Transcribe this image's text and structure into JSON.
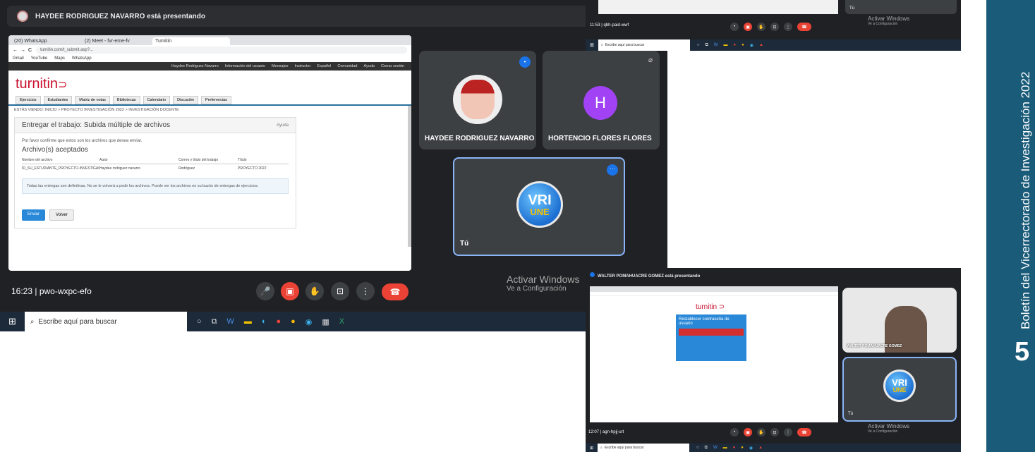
{
  "main": {
    "presenter_banner": "HAYDEE RODRIGUEZ NAVARRO está presentando",
    "browser": {
      "tabs": [
        "(20) WhatsApp",
        "(2) Meet - fvr-eme-fv",
        "Turnitin"
      ],
      "url": "turnitin.com/t_submit.asp?...",
      "bookmarks": [
        "Gmail",
        "YouTube",
        "Maps",
        "WhatsApp"
      ],
      "topnav": [
        "Haydee Rodriguez Navarro",
        "Información del usuario",
        "Mensajes",
        "Instructor",
        "Español",
        "Comunidad",
        "Ayuda",
        "Cerrar sesión"
      ],
      "logo": "turnitin",
      "menu_tabs": [
        "Ejercicios",
        "Estudiantes",
        "Matriz de notas",
        "Bibliotecas",
        "Calendario",
        "Discusión",
        "Preferencias"
      ],
      "breadcrumb": "ESTÁS VIENDO: INICIO > PROYECTO INVESTIGACIÓN 2022 > INVESTIGACIÓN DOCENTE",
      "panel_title": "Entregar el trabajo: Subida múltiple de archivos",
      "panel_help": "Ayuda",
      "instruction": "Por favor confirme que estos son los archivos que desea enviar.",
      "accepted_title": "Archivo(s) aceptados",
      "table_headers": [
        "Nombre del archivo",
        "Autor",
        "Correo y título del trabajo",
        "Título"
      ],
      "table_row": [
        "ID_SU_ESTUDIANTE_PROYECTO-INVESTIGACION-2022",
        "Haydee rodriguez navarro",
        "Rodríguez",
        "PROYECTO 2022"
      ],
      "notice": "Todas las entregas son definitivas. No se le volverá a pedir los archivos. Puede ver los archivos en su buzón de entregas de ejercicios.",
      "confirm": "Enviar",
      "cancel": "Volver"
    },
    "participants": [
      {
        "name": "HAYDEE RODRIGUEZ NAVARRO"
      },
      {
        "name": "HORTENCIO FLORES FLORES",
        "initial": "H"
      },
      {
        "name": "Tú"
      }
    ],
    "logo": {
      "top": "VRI",
      "bottom": "UNE"
    },
    "activate_title": "Activar Windows",
    "activate_sub": "Ve a Configuración",
    "time": "16:23",
    "meeting_code": "pwo-wxpc-efo",
    "search_placeholder": "Escribe aquí para buscar"
  },
  "top_right": {
    "time": "11:53",
    "code": "qbh-paid-wwf",
    "you": "Tú",
    "activate_title": "Activar Windows",
    "activate_sub": "Ve a Configuración",
    "search_placeholder": "Escribe aquí para buscar"
  },
  "bottom_right": {
    "presenter_banner": "WALTER POMAHUACRE GOMEZ está presentando",
    "logo": "turnitin",
    "card_title": "Restablecer contraseña de usuario",
    "participant_name": "WALTER POMAHUACRE GOMEZ",
    "you": "Tú",
    "logo_top": "VRI",
    "logo_bottom": "UNE",
    "time": "12:07",
    "code": "agn-hpjj-urt",
    "activate_title": "Activar Windows",
    "activate_sub": "Ve a Configuración",
    "search_placeholder": "Escribe aquí para buscar"
  },
  "sidebar": {
    "title": "Boletín del Vicerrectorado de Investigación 2022",
    "page": "5"
  },
  "colors": {
    "meet_bg": "#202124",
    "red": "#ea4335",
    "sidebar": "#1a5b79",
    "turnitin": "#c8102e"
  }
}
